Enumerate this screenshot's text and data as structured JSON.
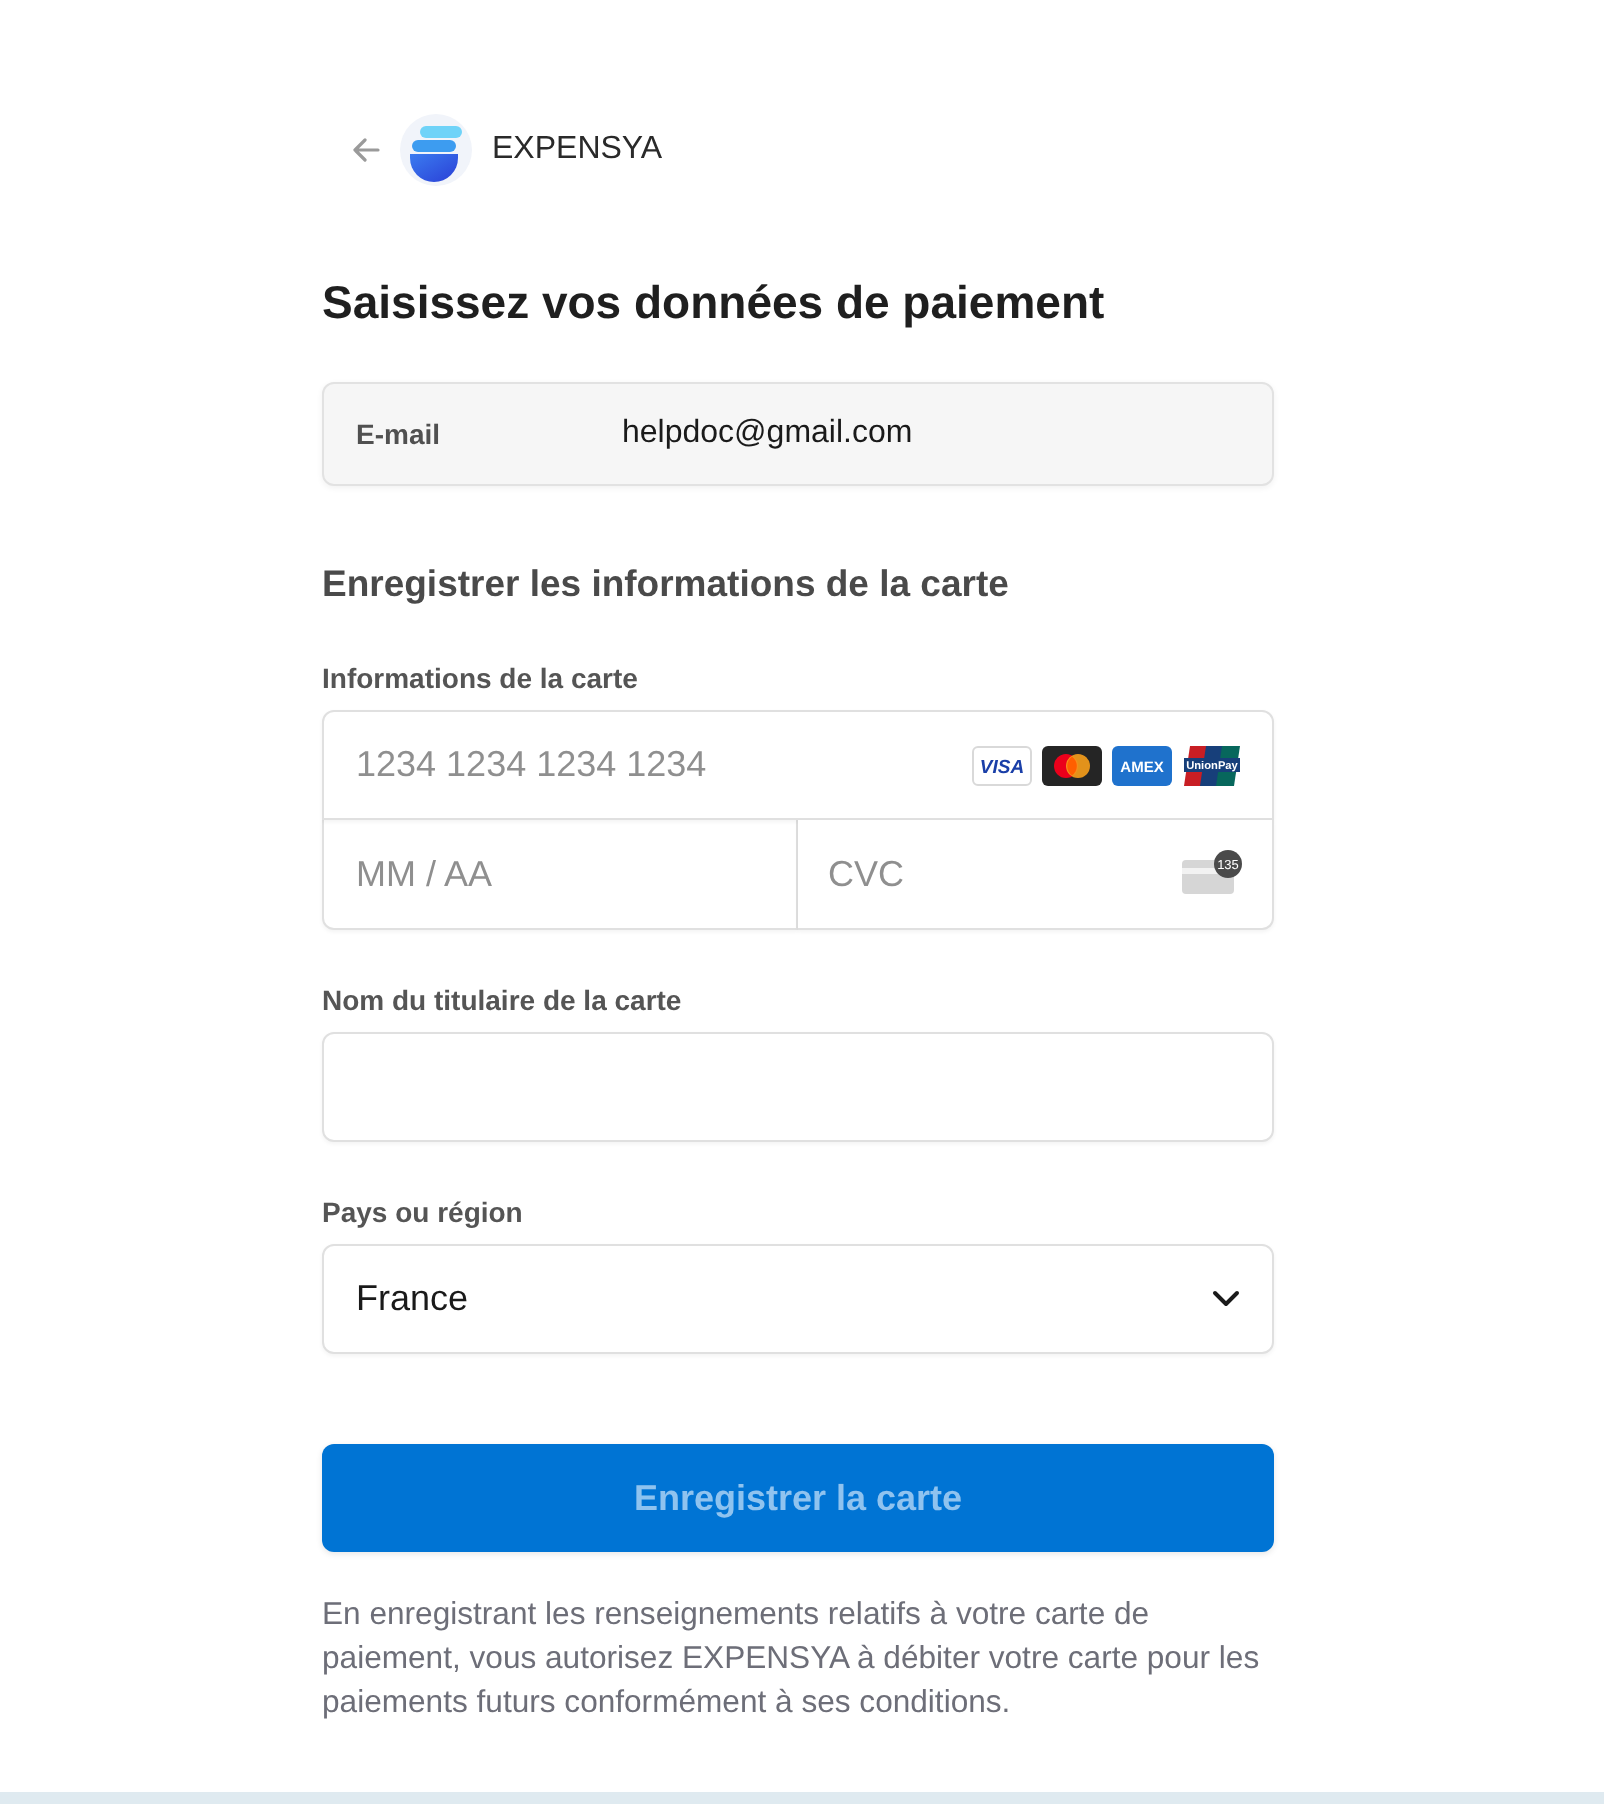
{
  "header": {
    "brand": "EXPENSYA"
  },
  "title": "Saisissez vos données de paiement",
  "email": {
    "label": "E-mail",
    "value": "helpdoc@gmail.com"
  },
  "card": {
    "heading": "Enregistrer les informations de la carte",
    "label": "Informations de la carte",
    "number": {
      "placeholder": "1234 1234 1234 1234"
    },
    "brands": [
      {
        "kind": "visa",
        "label": "VISA"
      },
      {
        "kind": "mastercard"
      },
      {
        "kind": "amex",
        "label": "AMEX"
      },
      {
        "kind": "unionpay",
        "label": "UnionPay"
      }
    ],
    "expiry": {
      "placeholder": "MM / AA"
    },
    "cvc": {
      "placeholder": "CVC",
      "hint": "135"
    }
  },
  "cardholder": {
    "label": "Nom du titulaire de la carte"
  },
  "country": {
    "label": "Pays ou région",
    "value": "France"
  },
  "submit": {
    "label": "Enregistrer la carte",
    "disabled": true
  },
  "disclaimer": "En enregistrant les renseignements relatifs à votre carte de paiement, vous autorisez EXPENSYA à débiter votre carte pour les paiements futurs conformément à ses conditions."
}
